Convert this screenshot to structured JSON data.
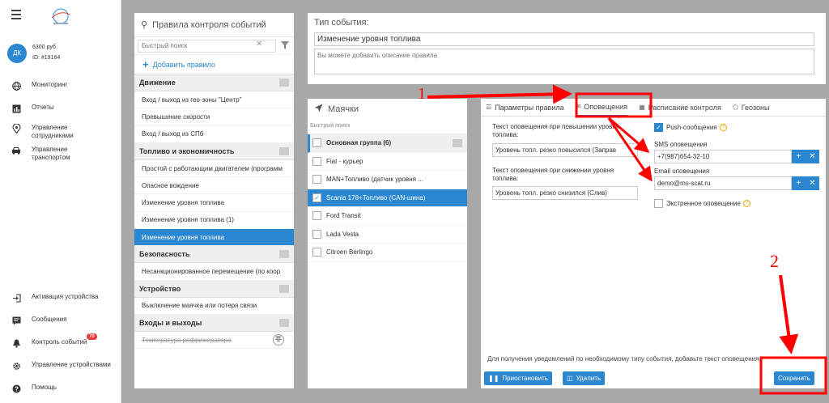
{
  "nav": {
    "balance": "6300 руб.",
    "account_id": "ID: #19164",
    "avatar": "ДК",
    "items_top": [
      {
        "label": "Мониторинг",
        "icon": "globe-icon"
      },
      {
        "label": "Отчеты",
        "icon": "bar-chart-icon"
      },
      {
        "label": "Управление\nсотрудниками",
        "icon": "map-pin-icon"
      },
      {
        "label": "Управление\nтранспортом",
        "icon": "car-icon"
      }
    ],
    "items_bottom": [
      {
        "label": "Активация устройства",
        "icon": "sign-in-icon"
      },
      {
        "label": "Сообщения",
        "icon": "message-icon"
      },
      {
        "label": "Контроль событий",
        "icon": "bell-icon",
        "badge": "70"
      },
      {
        "label": "Управление устройствами",
        "icon": "gear-icon"
      },
      {
        "label": "Помощь",
        "icon": "help-icon"
      }
    ]
  },
  "rules": {
    "title": "Правила контроля событий",
    "search_placeholder": "Быстрый поиск",
    "add_rule": "Добавить правило",
    "groups": [
      {
        "name": "Движение",
        "items": [
          "Вход / выход из гео-зоны \"Центр\"",
          "Превышение скорости",
          "Вход / выход из СПб"
        ]
      },
      {
        "name": "Топливо и экономичность",
        "items": [
          "Простой с работающим двигателем (программ",
          "Опасное вождение",
          "Изменение уровня топлива",
          "Изменение уровня топлива (1)",
          "Изменение уровня топлива"
        ]
      },
      {
        "name": "Безопасность",
        "items": [
          "Несанкционированное перемещение (по коор"
        ]
      },
      {
        "name": "Устройство",
        "items": [
          "Выключение маячка или потеря связи"
        ]
      },
      {
        "name": "Входы и выходы",
        "items": [
          "Температура рефрижератора"
        ]
      }
    ]
  },
  "event_type": {
    "title": "Тип события:",
    "name_value": "Изменение уровня топлива",
    "description_placeholder": "Вы можете добавить описание правила"
  },
  "beacons": {
    "title": "Маячки",
    "search_label": "Быстрый поиск",
    "group": "Основная группа (6)",
    "items": [
      {
        "label": "Fiat - курьер",
        "checked": false
      },
      {
        "label": "MAN+Топливо (датчик уровня ...",
        "checked": false
      },
      {
        "label": "Scania 178+Топливо (CAN-шина)",
        "checked": true
      },
      {
        "label": "Ford Transit",
        "checked": false
      },
      {
        "label": "Lada Vesta",
        "checked": false
      },
      {
        "label": "Citroen Berlingo",
        "checked": false
      }
    ]
  },
  "settings": {
    "tabs": [
      {
        "label": "Параметры правила",
        "icon": "sliders-icon"
      },
      {
        "label": "Оповещения",
        "icon": "notifications-icon"
      },
      {
        "label": "Расписание контроля",
        "icon": "calendar-icon"
      },
      {
        "label": "Геозоны",
        "icon": "pentagon-icon"
      }
    ],
    "raise_label": "Текст оповещения при повышении уровня топлива:",
    "raise_value": "Уровень топл. резко повысился (Заправ",
    "drop_label": "Текст оповещения при снижении уровня топлива:",
    "drop_value": "Уровень топл. резко снизился (Слив)",
    "push_label": "Push-сообщения",
    "sms_label": "SMS оповещения",
    "sms_value": "+7(987)654-32-10",
    "email_label": "Email оповещения",
    "email_value": "demo@ms-scat.ru",
    "emergency_label": "Экстренное оповещение",
    "hint": "Для получения уведомлений по необходимому типу события, добавьте текст оповещения.",
    "pause_button": "Приостановить",
    "delete_button": "Удалить",
    "save_button": "Сохранить"
  },
  "annotations": {
    "step1": "1",
    "step2": "2"
  },
  "colors": {
    "accent": "#2a87d0",
    "annotation": "#ff0000"
  }
}
